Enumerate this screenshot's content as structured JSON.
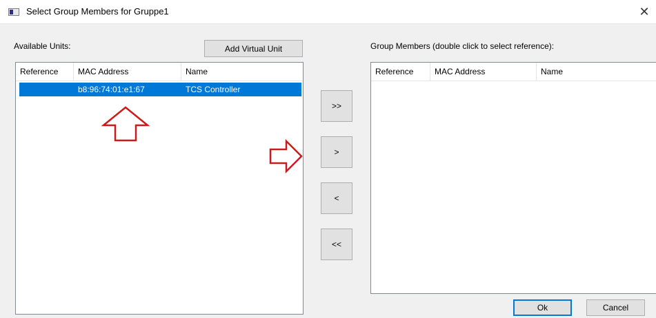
{
  "window": {
    "title": "Select Group Members for Gruppe1",
    "app_icon": "window-app-icon",
    "close_icon": "close-icon",
    "close_glyph": "✕"
  },
  "available": {
    "label": "Available Units:",
    "add_virtual_label": "Add Virtual Unit",
    "columns": [
      "Reference",
      "MAC Address",
      "Name"
    ],
    "rows": [
      {
        "reference": "",
        "mac": "b8:96:74:01:e1:67",
        "name": "TCS Controller",
        "selected": true
      }
    ]
  },
  "members": {
    "label": "Group Members (double click to select reference):",
    "columns": [
      "Reference",
      "MAC Address",
      "Name"
    ],
    "rows": []
  },
  "transfer_buttons": {
    "add_all": ">>",
    "add_one": ">",
    "remove_one": "<",
    "remove_all": "<<"
  },
  "footer": {
    "ok_label": "Ok",
    "cancel_label": "Cancel"
  },
  "annotations": {
    "arrow_color": "#cc1a1a",
    "up_arrow_icon": "red-up-arrow-icon",
    "right_arrow_icon": "red-right-arrow-icon"
  },
  "colors": {
    "selection": "#0078d7",
    "dialog_bg": "#f0f0f0"
  }
}
